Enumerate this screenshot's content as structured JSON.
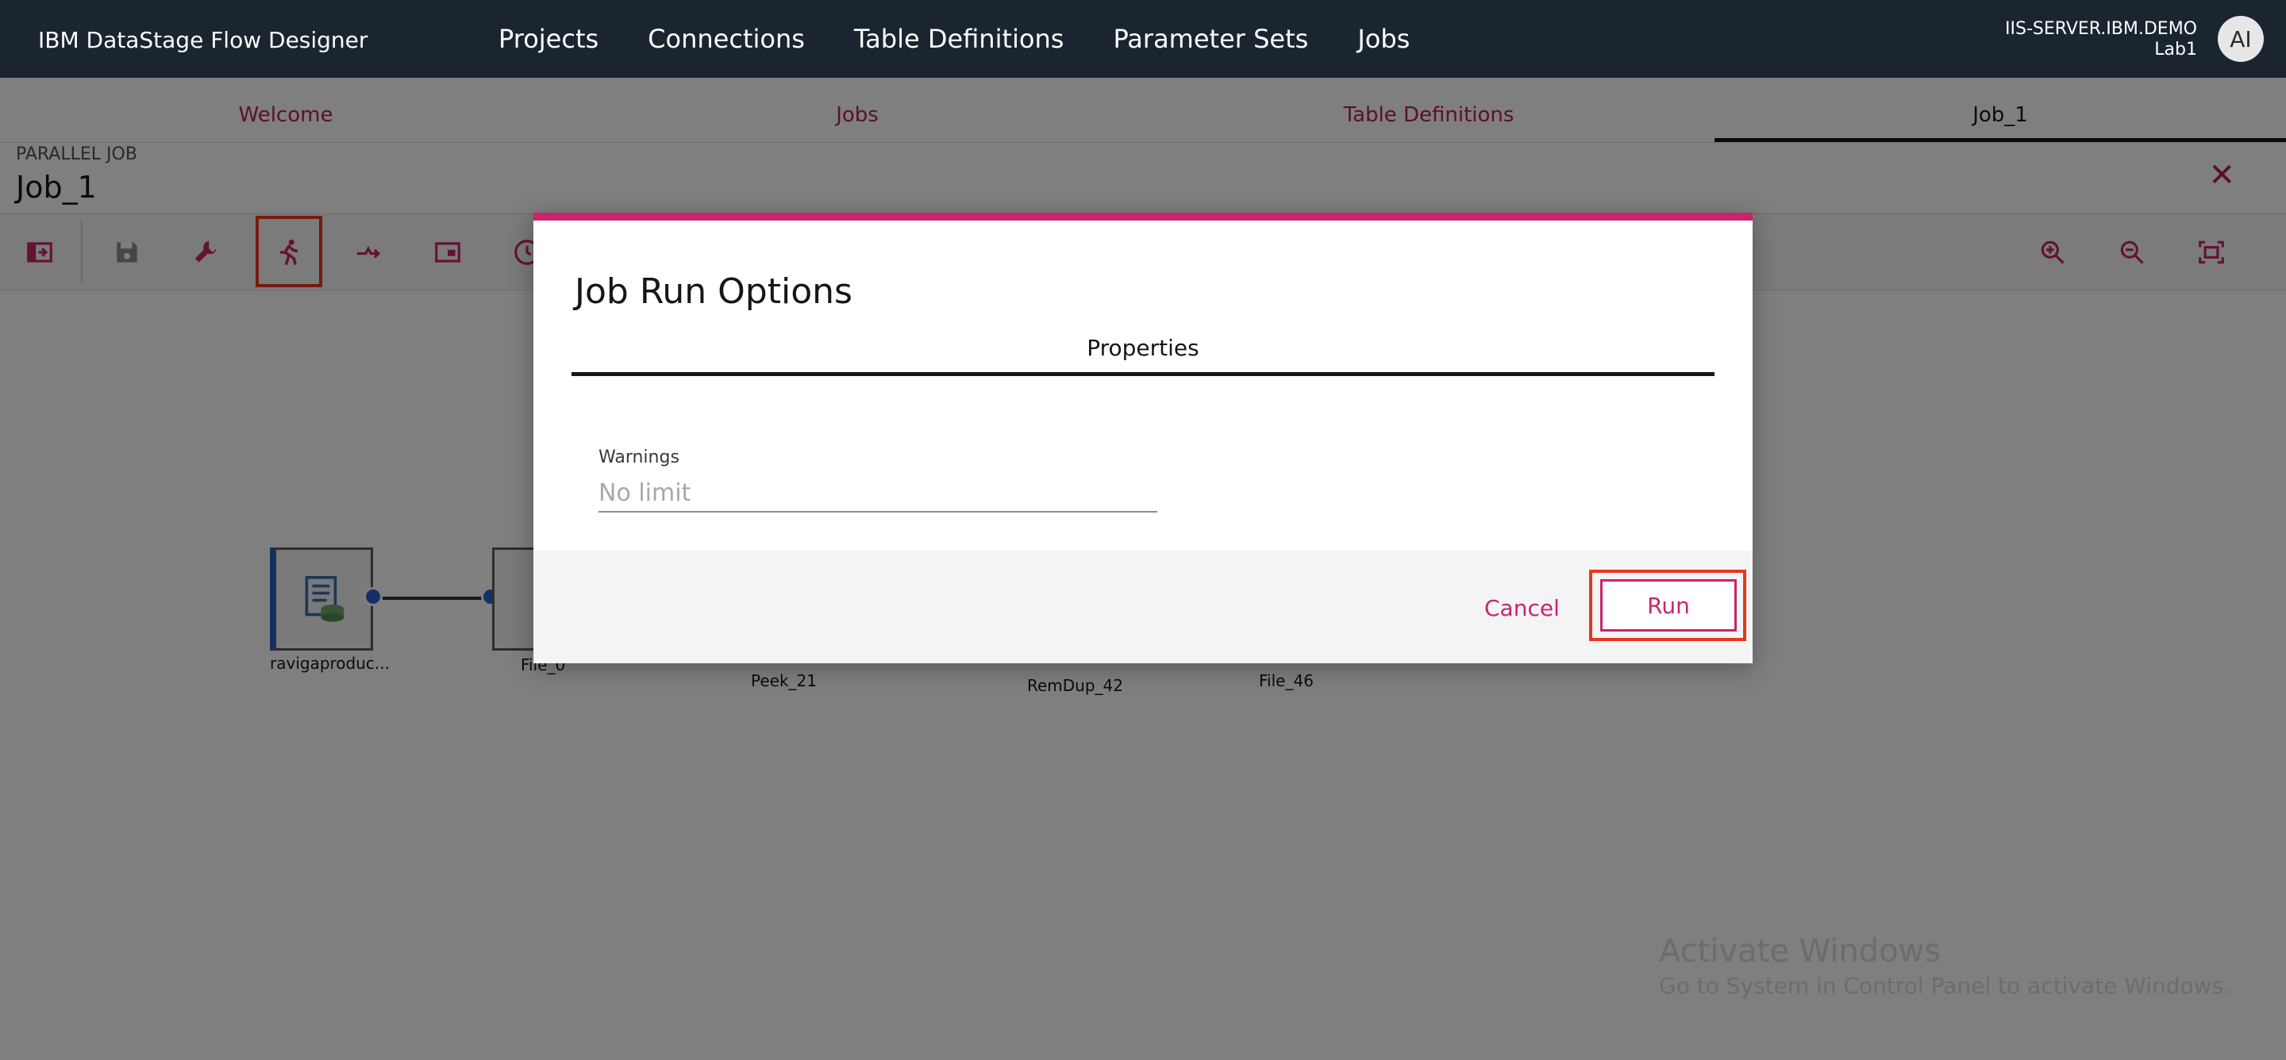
{
  "app": {
    "title": "IBM DataStage Flow Designer",
    "nav": [
      "Projects",
      "Connections",
      "Table Definitions",
      "Parameter Sets",
      "Jobs"
    ],
    "server": "IIS-SERVER.IBM.DEMO",
    "project": "Lab1",
    "avatar": "AI"
  },
  "tabs": [
    "Welcome",
    "Jobs",
    "Table Definitions",
    "Job_1"
  ],
  "job": {
    "type": "PARALLEL JOB",
    "name": "Job_1",
    "close_icon": "close-icon"
  },
  "toolbar": {
    "icons": [
      "toggle-palette-icon",
      "save-icon",
      "wrench-icon",
      "run-icon",
      "compile-icon",
      "properties-icon",
      "schedule-icon",
      "zoom-in-icon",
      "zoom-out-icon",
      "fit-to-screen-icon"
    ]
  },
  "canvas": {
    "nodes": [
      "ravigaproduc...",
      "File_0",
      "Peek_21",
      "RemDup_42",
      "File_46"
    ]
  },
  "watermark": {
    "line1": "Activate Windows",
    "line2": "Go to System in Control Panel to activate Windows."
  },
  "dialog": {
    "title": "Job Run Options",
    "tab": "Properties",
    "warnings_label": "Warnings",
    "warnings_placeholder": "No limit",
    "cancel_label": "Cancel",
    "run_label": "Run",
    "accent_color": "#c7256c",
    "highlight_color": "#e8371f"
  }
}
